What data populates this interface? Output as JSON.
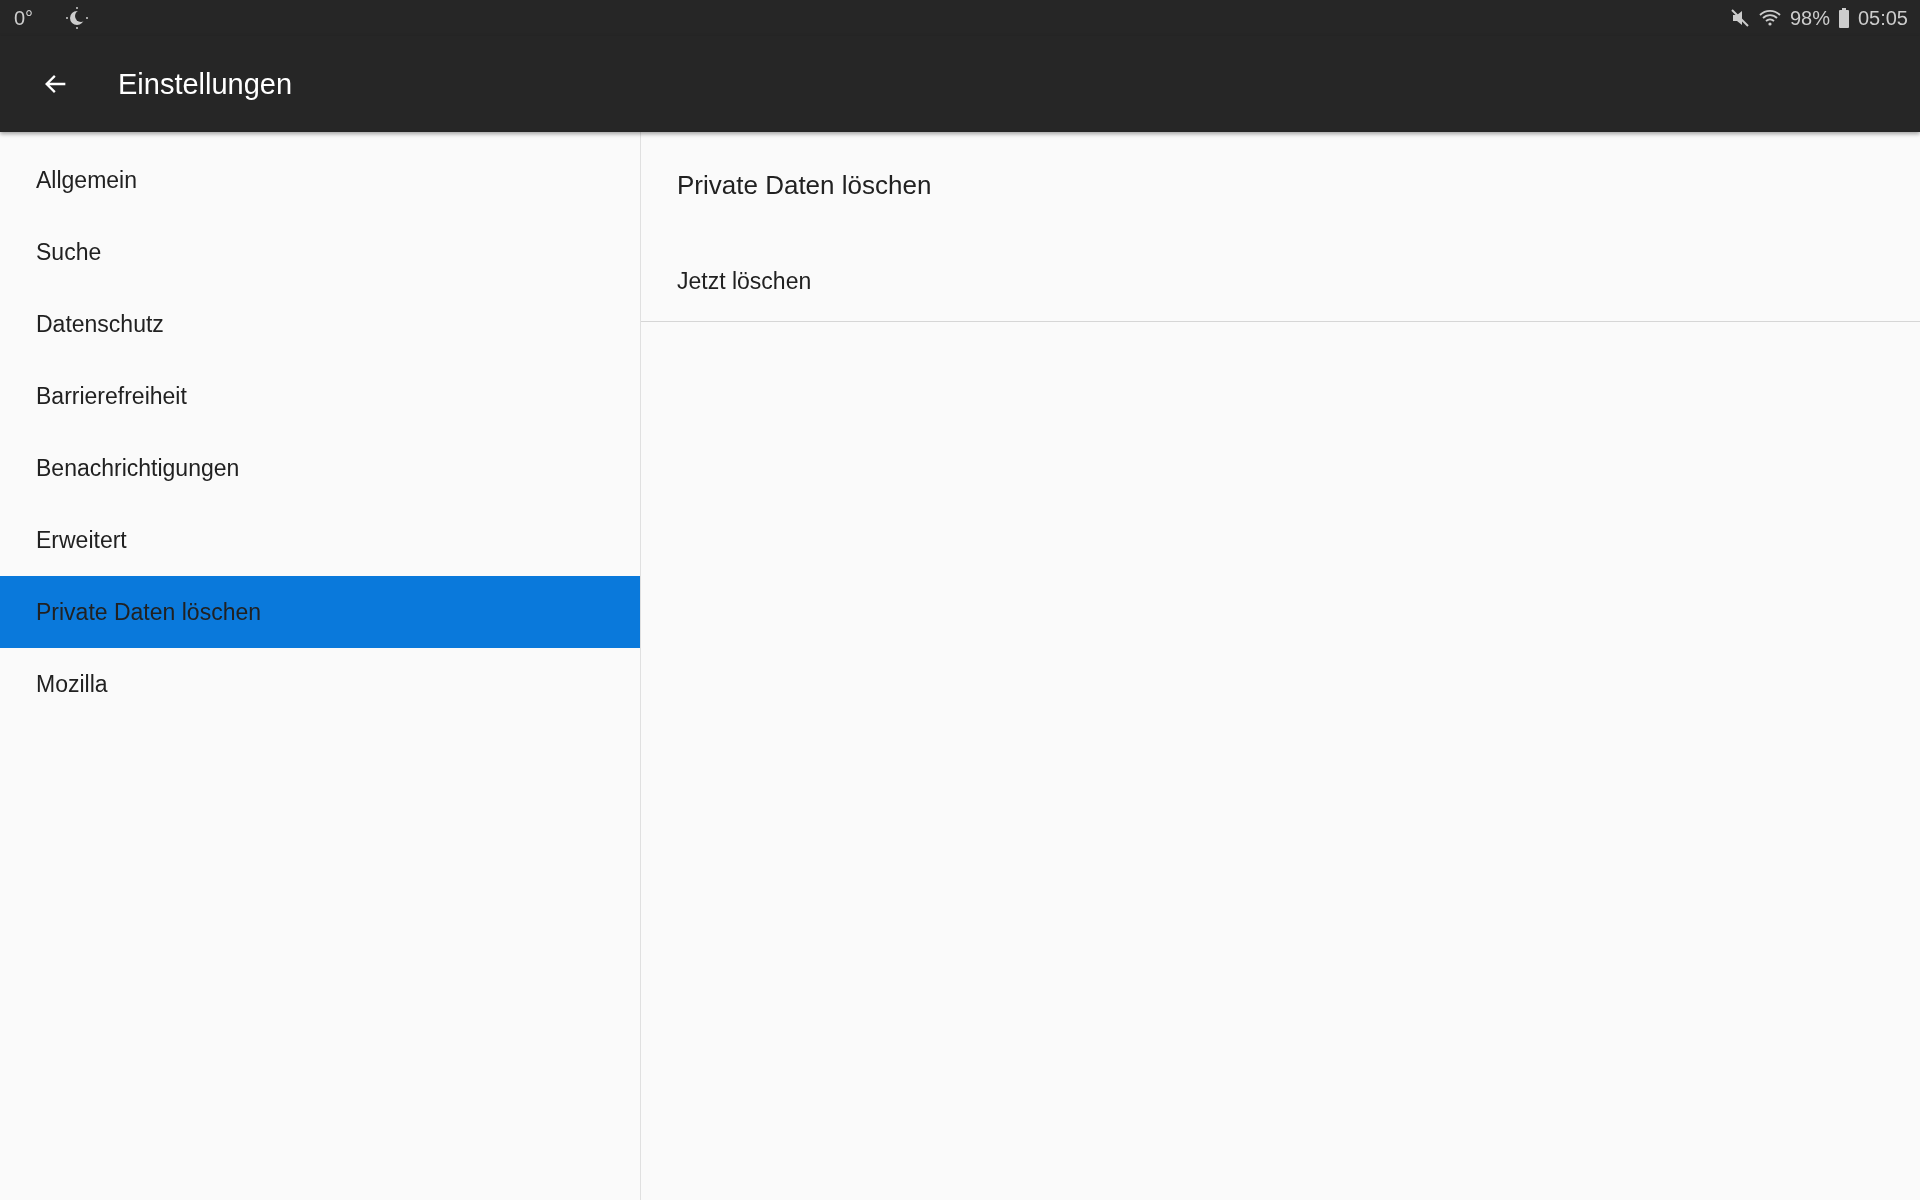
{
  "status_bar": {
    "temperature": "0°",
    "battery": "98%",
    "time": "05:05"
  },
  "app_bar": {
    "title": "Einstellungen"
  },
  "sidebar": {
    "items": [
      {
        "label": "Allgemein",
        "selected": false
      },
      {
        "label": "Suche",
        "selected": false
      },
      {
        "label": "Datenschutz",
        "selected": false
      },
      {
        "label": "Barrierefreiheit",
        "selected": false
      },
      {
        "label": "Benachrichtigungen",
        "selected": false
      },
      {
        "label": "Erweitert",
        "selected": false
      },
      {
        "label": "Private Daten löschen",
        "selected": true
      },
      {
        "label": "Mozilla",
        "selected": false
      }
    ]
  },
  "detail": {
    "heading": "Private Daten löschen",
    "items": [
      {
        "label": "Jetzt löschen"
      }
    ]
  }
}
